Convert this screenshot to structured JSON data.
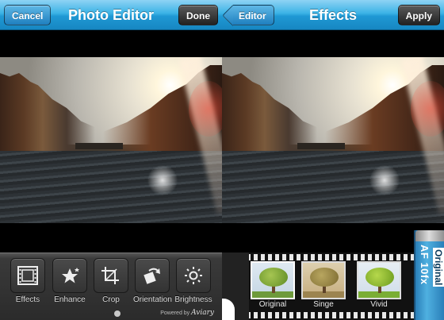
{
  "left": {
    "title": "Photo Editor",
    "cancel_label": "Cancel",
    "done_label": "Done",
    "tools": [
      {
        "label": "Effects",
        "icon": "film-frame-icon"
      },
      {
        "label": "Enhance",
        "icon": "sparkle-star-icon"
      },
      {
        "label": "Crop",
        "icon": "crop-icon"
      },
      {
        "label": "Orientation",
        "icon": "rotate-icon"
      },
      {
        "label": "Brightness",
        "icon": "sun-icon"
      }
    ],
    "powered_by": "Powered by",
    "powered_brand": "Aviary"
  },
  "right": {
    "title": "Effects",
    "back_label": "Editor",
    "apply_label": "Apply",
    "effects": [
      {
        "label": "Original",
        "selected": true
      },
      {
        "label": "Singe",
        "selected": false
      },
      {
        "label": "Vivid",
        "selected": false
      }
    ],
    "canister_text": "AF 10fx",
    "canister_label": "Original"
  },
  "colors": {
    "navbar_blue": "#1f98d4",
    "toolbar_dark": "#2b2b2b",
    "canister_blue": "#2a7fb9"
  }
}
